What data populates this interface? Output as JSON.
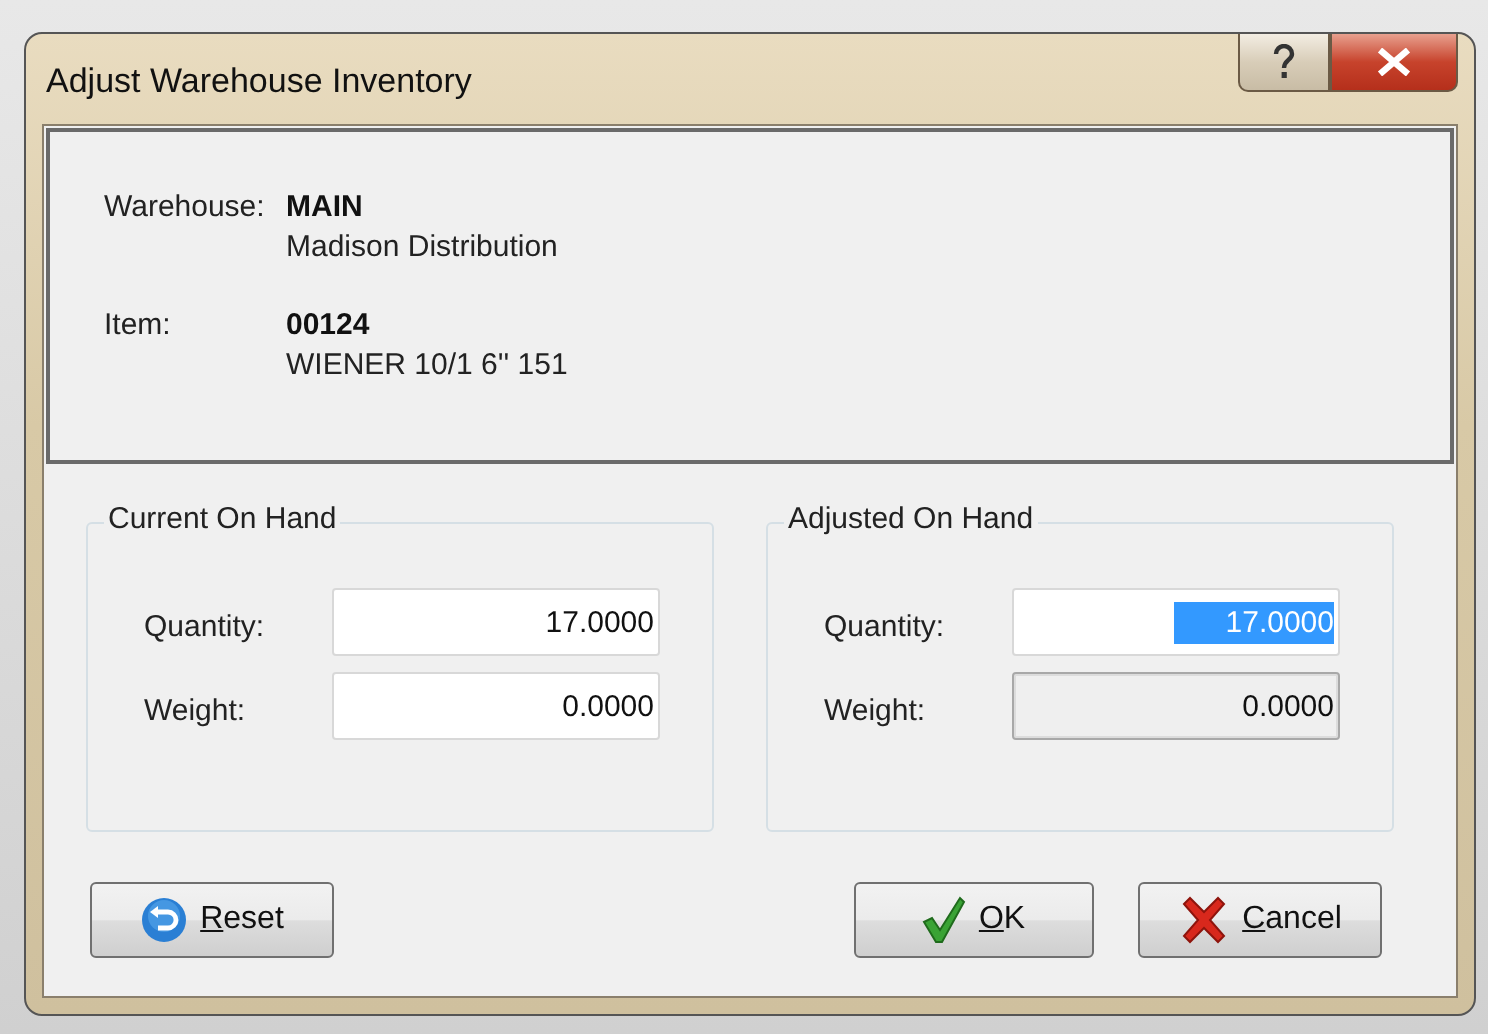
{
  "window": {
    "title": "Adjust Warehouse Inventory"
  },
  "info": [
    {
      "label": "Warehouse:",
      "value": "MAIN",
      "detail": "Madison Distribution"
    },
    {
      "label": "Item:",
      "value": "00124",
      "detail": "WIENER 10/1 6''  151"
    }
  ],
  "groups": [
    {
      "title": "Current On Hand",
      "fields": [
        {
          "label": "Quantity:",
          "value": "17.0000",
          "disabled": false,
          "selected": false
        },
        {
          "label": "Weight:",
          "value": "0.0000",
          "disabled": false,
          "selected": false
        }
      ]
    },
    {
      "title": "Adjusted On Hand",
      "fields": [
        {
          "label": "Quantity:",
          "value": "17.0000",
          "disabled": false,
          "selected": true
        },
        {
          "label": "Weight:",
          "value": "0.0000",
          "disabled": true,
          "selected": false
        }
      ]
    }
  ],
  "buttons": [
    {
      "kind": "reset",
      "label": "Reset",
      "underline_first": true
    },
    {
      "kind": "ok",
      "label": "OK",
      "underline_first": true
    },
    {
      "kind": "cancel",
      "label": "Cancel",
      "underline_first": true
    }
  ]
}
